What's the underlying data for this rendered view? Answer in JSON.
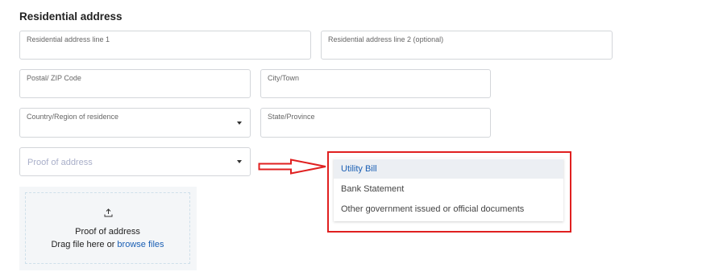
{
  "section": {
    "title": "Residential address"
  },
  "fields": {
    "address_line1": {
      "label": "Residential address line 1"
    },
    "address_line2": {
      "label": "Residential address line 2 (optional)"
    },
    "postal": {
      "label": "Postal/ ZIP Code"
    },
    "city": {
      "label": "City/Town"
    },
    "country": {
      "label": "Country/Region of residence"
    },
    "state": {
      "label": "State/Province"
    },
    "proof": {
      "placeholder": "Proof of address"
    }
  },
  "upload": {
    "title": "Proof of address",
    "instruction": "Drag file here or",
    "link_text": "browse files"
  },
  "dropdown": {
    "options": [
      "Utility Bill",
      "Bank Statement",
      "Other government issued or official documents"
    ],
    "selected_index": 0
  },
  "annotation": {
    "arrow_color": "#e02020",
    "box_color": "#e02020"
  },
  "colors": {
    "link": "#1a5fb4",
    "placeholder": "#a9afc9"
  }
}
